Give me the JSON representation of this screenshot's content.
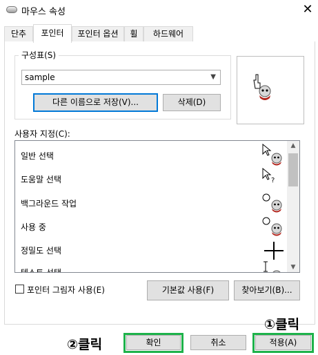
{
  "window": {
    "title": "마우스 속성",
    "close_label": "✕"
  },
  "tabs": [
    "단추",
    "포인터",
    "포인터 옵션",
    "휠",
    "하드웨어"
  ],
  "scheme": {
    "group_label": "구성표(S)",
    "selected": "sample",
    "save_as_label": "다른 이름으로 저장(V)...",
    "delete_label": "삭제(D)"
  },
  "customize": {
    "label": "사용자 지정(C):",
    "items": [
      "일반 선택",
      "도움말 선택",
      "백그라운드 작업",
      "사용 중",
      "정밀도 선택",
      "텍스트 선택"
    ]
  },
  "shadow_label": "포인터 그림자 사용(E)",
  "shadow_checked": false,
  "use_default_label": "기본값 사용(F)",
  "browse_label": "찾아보기(B)...",
  "footer": {
    "ok_label": "확인",
    "cancel_label": "취소",
    "apply_label": "적용(A)"
  },
  "annotations": {
    "apply_step": "①클릭",
    "ok_step": "②클릭",
    "highlight_color": "#1db24a"
  }
}
